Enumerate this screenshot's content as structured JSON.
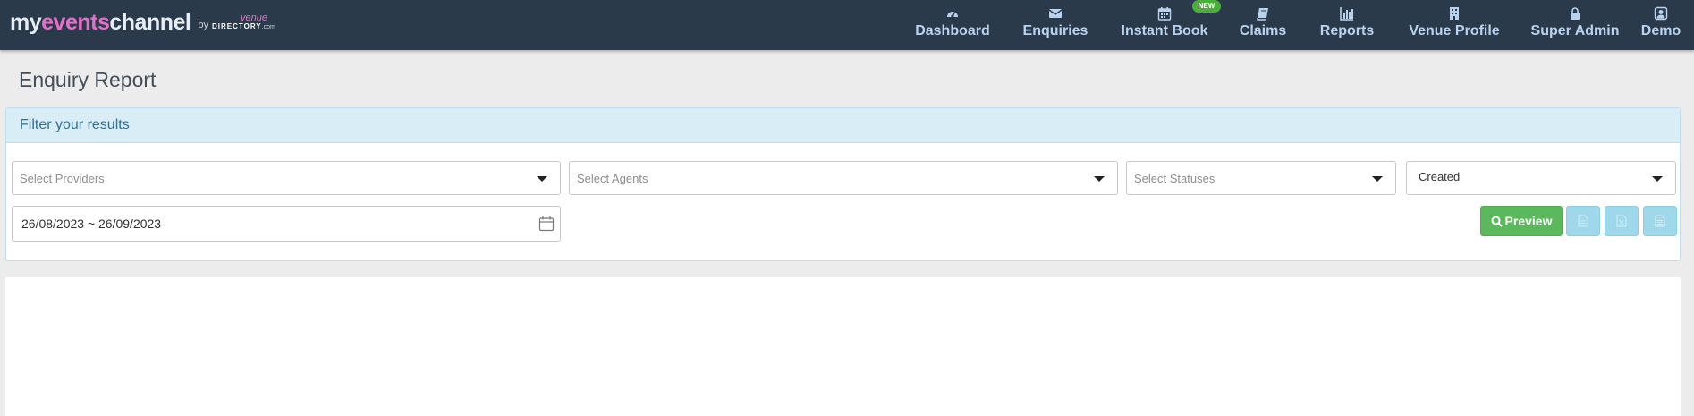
{
  "brand": {
    "my": "my",
    "events": "events",
    "channel": "channel",
    "by": "by",
    "venue": "venue",
    "directory": "DIRECTORY",
    "directory_suffix": ".com"
  },
  "nav": {
    "items": [
      {
        "label": "Dashboard",
        "icon": "dashboard-icon"
      },
      {
        "label": "Enquiries",
        "icon": "envelope-icon"
      },
      {
        "label": "Instant Book",
        "icon": "calendar-icon"
      },
      {
        "label": "Claims",
        "icon": "book-icon"
      },
      {
        "label": "Reports",
        "icon": "bar-chart-icon"
      },
      {
        "label": "Venue Profile",
        "icon": "building-icon"
      },
      {
        "label": "Super Admin",
        "icon": "lock-icon"
      },
      {
        "label": "Demo",
        "icon": "user-icon"
      }
    ],
    "new_badge": "NEW"
  },
  "page": {
    "title": "Enquiry Report"
  },
  "filter": {
    "heading": "Filter your results",
    "providers_placeholder": "Select Providers",
    "agents_placeholder": "Select Agents",
    "statuses_placeholder": "Select Statuses",
    "date_type_value": "Created",
    "date_range": "26/08/2023 ~ 26/09/2023",
    "preview_label": "Preview"
  },
  "colors": {
    "navbar_bg": "#2b3a4b",
    "nav_text": "#b9d3ee",
    "brand_accent": "#e46fc6",
    "panel_heading_bg": "#d9edf7",
    "preview_button": "#5cb85c",
    "export_button": "#9fd8eb"
  }
}
